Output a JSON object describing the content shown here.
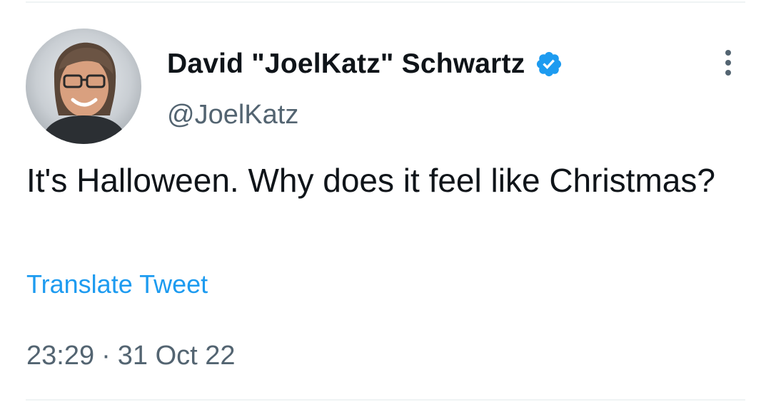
{
  "tweet": {
    "author": {
      "display_name": "David \"JoelKatz\" Schwartz",
      "handle": "@JoelKatz",
      "verified": true,
      "avatar_icon": "user-avatar"
    },
    "text": "It's Halloween. Why does it feel like Christmas?",
    "translate_label": "Translate Tweet",
    "time": "23:29",
    "separator": "·",
    "date": "31 Oct 22",
    "more_icon": "more-vertical-icon"
  },
  "colors": {
    "text_primary": "#0f1419",
    "text_secondary": "#536471",
    "accent": "#1d9bf0",
    "divider": "#eff3f4"
  }
}
